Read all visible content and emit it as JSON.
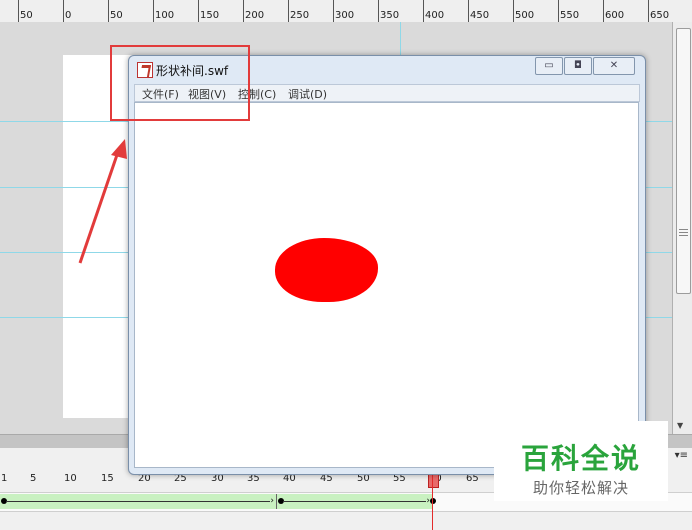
{
  "ruler": {
    "labels": [
      "50",
      "0",
      "50",
      "100",
      "150",
      "200",
      "250",
      "300",
      "350",
      "400",
      "450",
      "500",
      "550",
      "600",
      "650"
    ]
  },
  "swf_window": {
    "title": "形状补间.swf",
    "menus": [
      "文件(F)",
      "视图(V)",
      "控制(C)",
      "调试(D)"
    ],
    "buttons": {
      "minimize": "▭",
      "maximize": "◘",
      "close": "✕"
    },
    "ellipse_color": "#ff0000"
  },
  "timeline": {
    "frame_labels": [
      "1",
      "5",
      "10",
      "15",
      "20",
      "25",
      "30",
      "35",
      "40",
      "45",
      "50",
      "55",
      "60",
      "65"
    ],
    "current_frame": 60,
    "menu_icon": "▾≡"
  },
  "annotation": {
    "color": "#e23b3b"
  },
  "watermark": {
    "title": "百科全说",
    "subtitle": "助你轻松解决"
  }
}
